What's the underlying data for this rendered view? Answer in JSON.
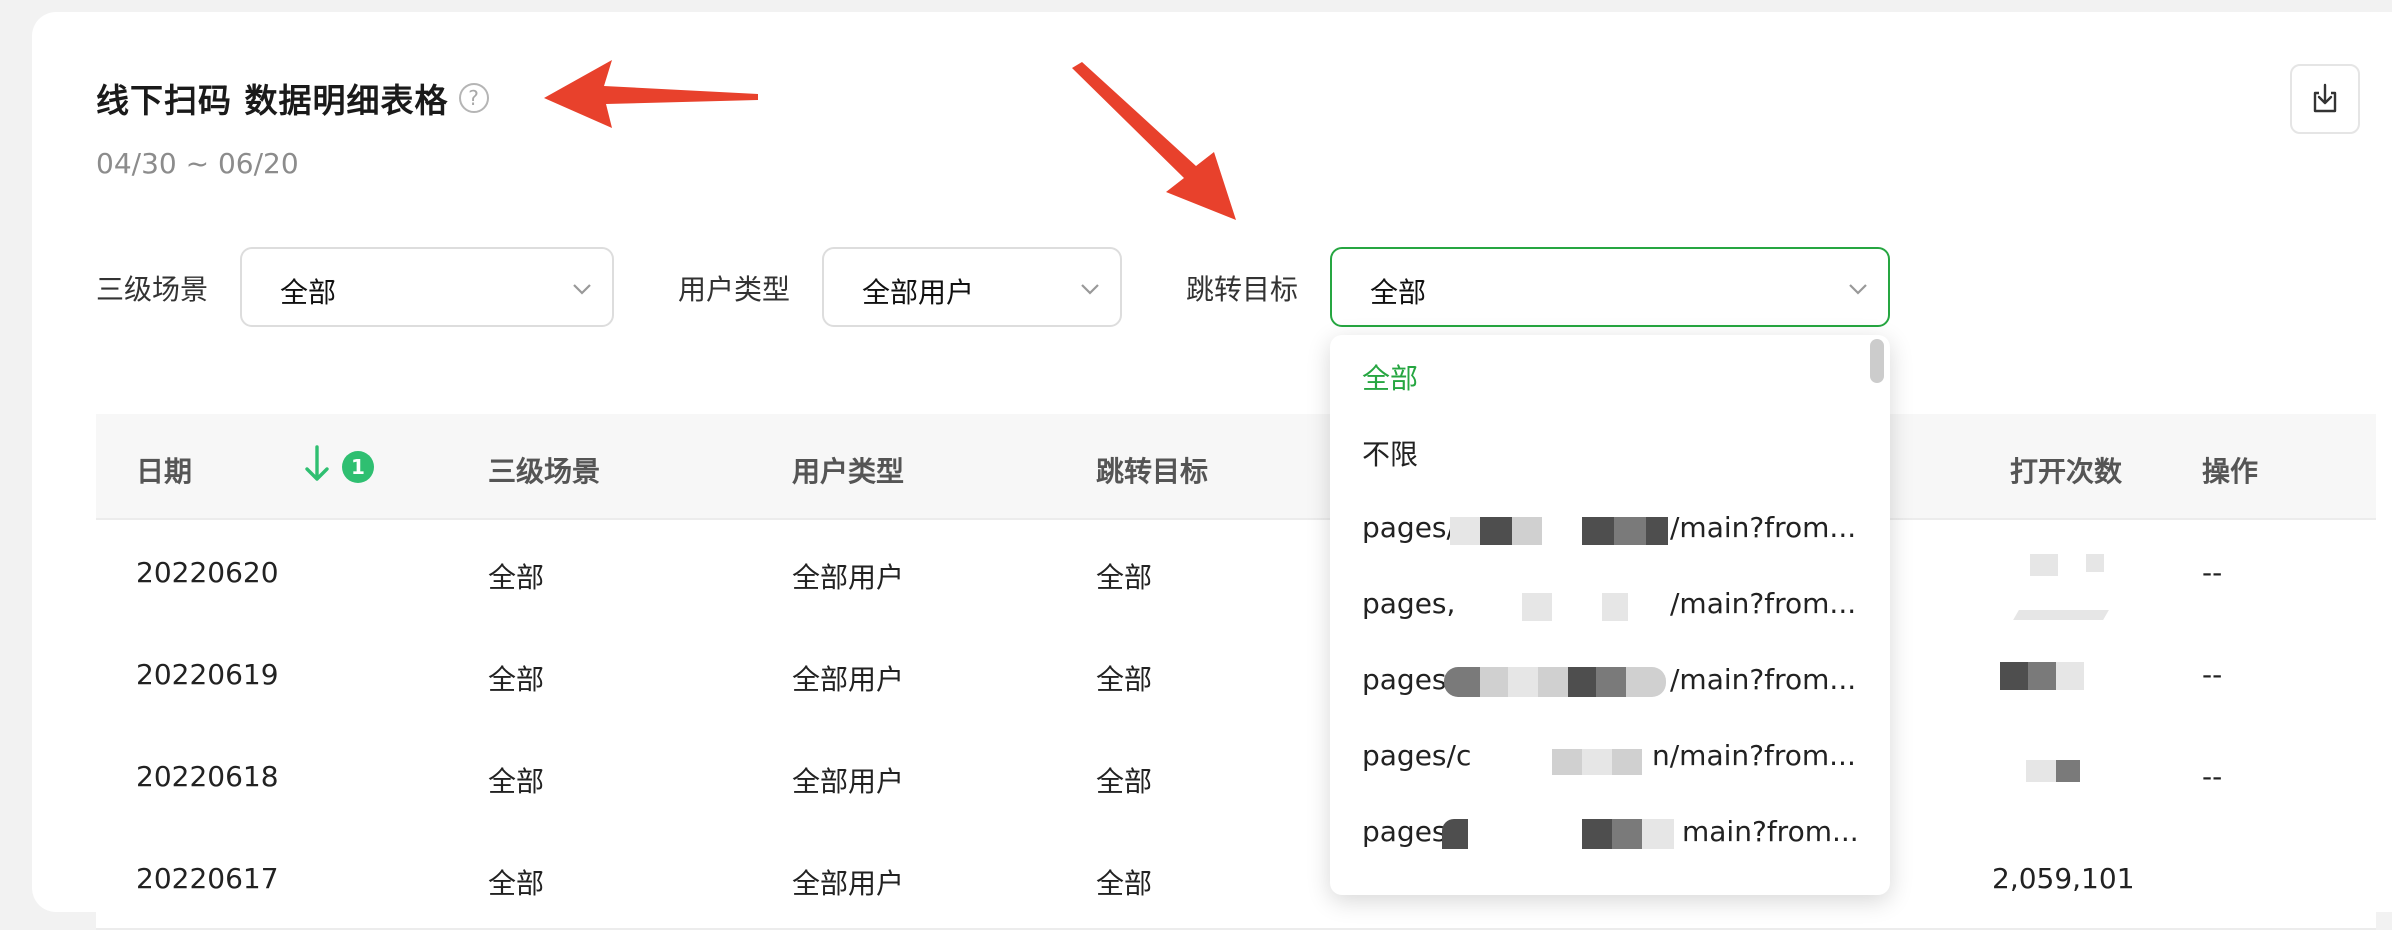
{
  "header": {
    "title": "线下扫码 数据明细表格",
    "help_icon_glyph": "?",
    "date_range": "04/30 ~ 06/20"
  },
  "filters": [
    {
      "label": "三级场景",
      "value": "全部"
    },
    {
      "label": "用户类型",
      "value": "全部用户"
    },
    {
      "label": "跳转目标",
      "value": "全部"
    }
  ],
  "table": {
    "columns": [
      "日期",
      "三级场景",
      "用户类型",
      "跳转目标",
      "打开次数",
      "操作"
    ],
    "sort_badge": "1",
    "rows": [
      {
        "date": "20220620",
        "scene": "全部",
        "user_type": "全部用户",
        "target": "全部",
        "action": "--"
      },
      {
        "date": "20220619",
        "scene": "全部",
        "user_type": "全部用户",
        "target": "全部",
        "action": "--"
      },
      {
        "date": "20220618",
        "scene": "全部",
        "user_type": "全部用户",
        "target": "全部",
        "action": "--"
      },
      {
        "date": "20220617",
        "scene": "全部",
        "user_type": "全部用户",
        "target": "全部",
        "open_count": "2,059,101",
        "action": ""
      }
    ]
  },
  "dropdown": {
    "options": [
      {
        "prefix": "全部",
        "suffix": ""
      },
      {
        "prefix": "不限",
        "suffix": ""
      },
      {
        "prefix": "pages/",
        "suffix": "/main?from..."
      },
      {
        "prefix": "pages,",
        "suffix": "/main?from..."
      },
      {
        "prefix": "pages",
        "suffix": "/main?from..."
      },
      {
        "prefix": "pages/c",
        "suffix": "n/main?from..."
      },
      {
        "prefix": "pages",
        "suffix": "main?from..."
      }
    ]
  },
  "colors": {
    "accent_green": "#26a641",
    "badge_green": "#2fbf71",
    "annotation_red": "#e8412c"
  }
}
